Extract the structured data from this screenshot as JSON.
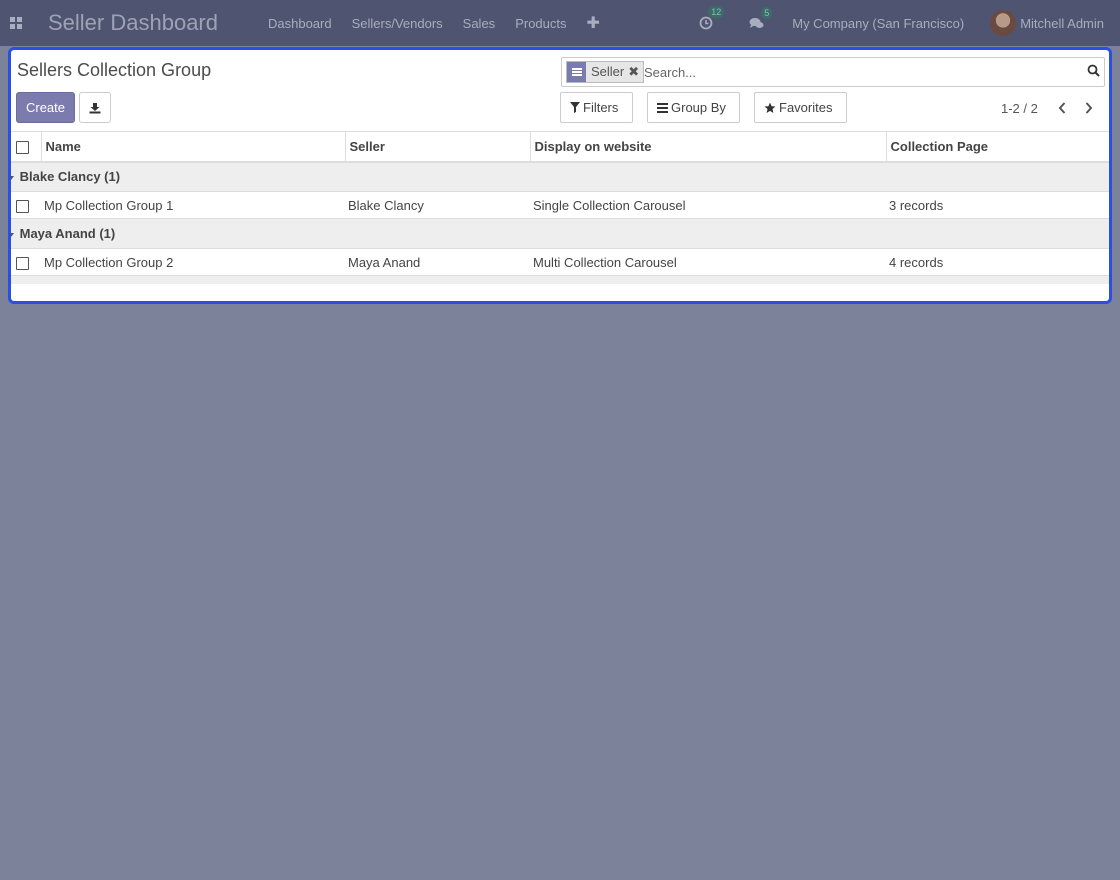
{
  "navbar": {
    "brand": "Seller Dashboard",
    "menu": [
      "Dashboard",
      "Sellers/Vendors",
      "Sales",
      "Products"
    ],
    "activity_count": "12",
    "message_count": "5",
    "company": "My Company (San Francisco)",
    "user": "Mitchell Admin"
  },
  "control_panel": {
    "title": "Sellers Collection Group",
    "create_label": "Create",
    "facet_label": "Seller",
    "facet_close": "✖",
    "search_placeholder": "Search...",
    "filters_label": "Filters",
    "groupby_label": "Group By",
    "favorites_label": "Favorites",
    "pager": "1-2 / 2"
  },
  "table": {
    "columns": [
      "Name",
      "Seller",
      "Display on website",
      "Collection Page"
    ],
    "groups": [
      {
        "label": "Blake Clancy (1)",
        "rows": [
          {
            "name": "Mp Collection Group 1",
            "seller": "Blake Clancy",
            "display": "Single Collection Carousel",
            "page": "3 records"
          }
        ]
      },
      {
        "label": "Maya Anand (1)",
        "rows": [
          {
            "name": "Mp Collection Group 2",
            "seller": "Maya Anand",
            "display": "Multi Collection Carousel",
            "page": "4 records"
          }
        ]
      }
    ]
  },
  "colors": {
    "navbar_bg": "#4f5470",
    "backdrop": "#7c8299",
    "primary": "#7c7bad",
    "focus_border": "#2b4fe0"
  }
}
